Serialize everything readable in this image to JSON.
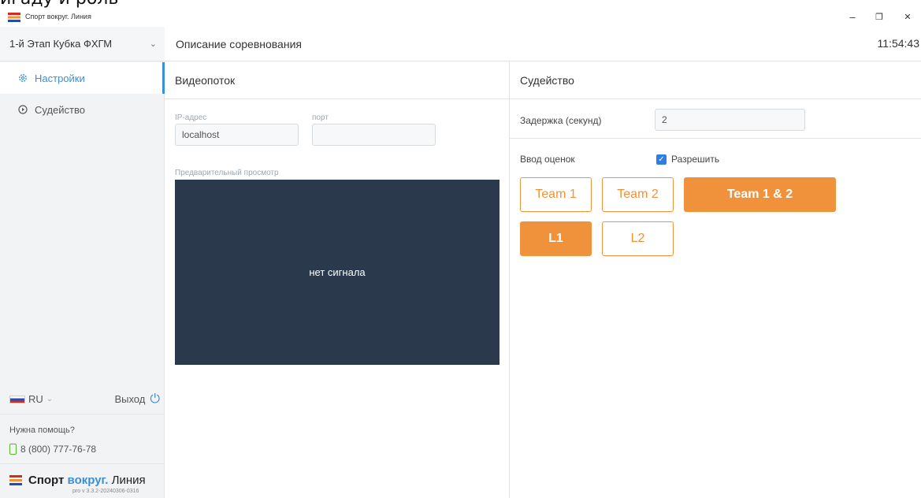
{
  "bleed_text": "игаду и роль",
  "window": {
    "app_title": "Спорт вокруг. Линия",
    "minimize": "–",
    "restore": "❐",
    "close": "✕"
  },
  "sidebar": {
    "event": "1-й Этап Кубка ФХГМ",
    "nav": [
      {
        "label": "Настройки",
        "icon": "gear-icon",
        "active": true
      },
      {
        "label": "Судейство",
        "icon": "play-circle-icon",
        "active": false
      }
    ],
    "language": "RU",
    "exit_label": "Выход",
    "help_label": "Нужна помощь?",
    "phone": "8 (800) 777-76-78",
    "brand": {
      "part1": "Спорт ",
      "part2": "вокруг.",
      "part3": " Линия",
      "version": "pro v 3.3.2-20240306-0316"
    }
  },
  "header": {
    "title": "Описание соревнования",
    "clock": "11:54:43"
  },
  "video": {
    "title": "Видеопоток",
    "ip_label": "IP-адрес",
    "ip_value": "localhost",
    "port_label": "порт",
    "port_value": "",
    "preview_label": "Предварительный просмотр",
    "no_signal": "нет сигнала"
  },
  "judging": {
    "title": "Судейство",
    "delay_label": "Задержка (секунд)",
    "delay_value": "2",
    "ratings_label": "Ввод оценок",
    "allow_label": "Разрешить",
    "allow_checked": true,
    "team_buttons": [
      {
        "label": "Team 1",
        "selected": false
      },
      {
        "label": "Team 2",
        "selected": false
      },
      {
        "label": "Team 1 & 2",
        "selected": true
      }
    ],
    "level_buttons": [
      {
        "label": "L1",
        "selected": true
      },
      {
        "label": "L2",
        "selected": false
      }
    ]
  },
  "colors": {
    "accent": "#f0923c",
    "link": "#3a8fd6",
    "preview_bg": "#2b394d"
  }
}
